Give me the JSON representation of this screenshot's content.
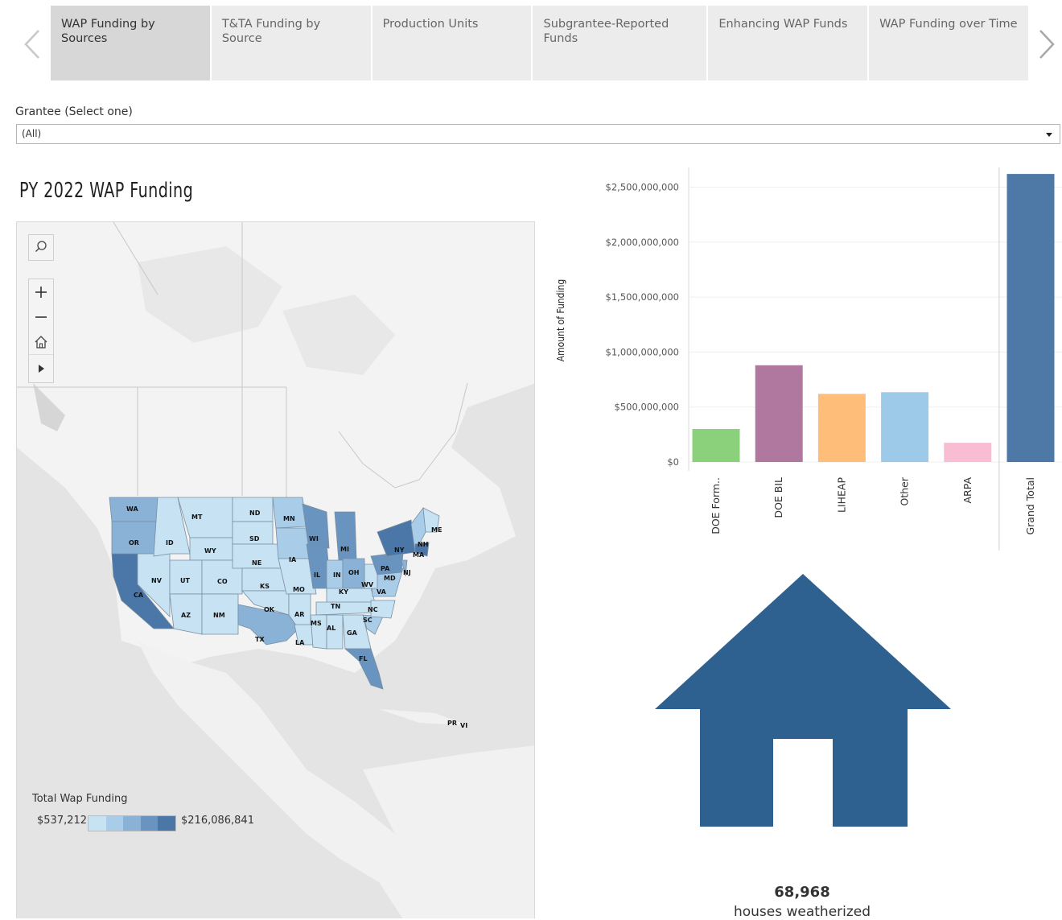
{
  "tabs": [
    {
      "label": "WAP Funding by Sources",
      "active": true
    },
    {
      "label": "T&TA Funding by Source",
      "active": false
    },
    {
      "label": "Production Units",
      "active": false
    },
    {
      "label": "Subgrantee-Reported Funds",
      "active": false
    },
    {
      "label": "Enhancing WAP Funds",
      "active": false
    },
    {
      "label": "WAP Funding over Time",
      "active": false
    }
  ],
  "filter": {
    "label": "Grantee (Select one)",
    "value": "(All)"
  },
  "title": "PY 2022 WAP Funding",
  "map": {
    "legend_title": "Total Wap Funding",
    "legend_min": "$537,212",
    "legend_max": "$216,086,841",
    "legend_colors": [
      "#c6e2f3",
      "#a9cde8",
      "#89b2d6",
      "#6994c0",
      "#4a76a8"
    ],
    "state_labels": [
      "WA",
      "OR",
      "CA",
      "NV",
      "ID",
      "MT",
      "WY",
      "UT",
      "AZ",
      "CO",
      "NM",
      "ND",
      "SD",
      "NE",
      "KS",
      "OK",
      "TX",
      "MN",
      "IA",
      "MO",
      "AR",
      "LA",
      "WI",
      "IL",
      "MI",
      "IN",
      "OH",
      "KY",
      "TN",
      "MS",
      "AL",
      "GA",
      "FL",
      "SC",
      "NC",
      "VA",
      "WV",
      "PA",
      "NY",
      "MD",
      "ME",
      "NH",
      "MA",
      "NJ",
      "PR",
      "VI"
    ]
  },
  "chart_data": {
    "type": "bar",
    "ylabel": "Amount of Funding",
    "yticks": [
      "$0",
      "$500,000,000",
      "$1,000,000,000",
      "$1,500,000,000",
      "$2,000,000,000",
      "$2,500,000,000"
    ],
    "ylim": [
      0,
      2750000000
    ],
    "categories": [
      "DOE Form..",
      "DOE BIL",
      "LIHEAP",
      "Other",
      "ARPA",
      "Grand Total"
    ],
    "values": [
      300000000,
      880000000,
      620000000,
      635000000,
      175000000,
      2620000000
    ],
    "colors": [
      "#8bd17c",
      "#b0789f",
      "#ffbd7a",
      "#9ecae9",
      "#f8bcd3",
      "#4e79a7"
    ]
  },
  "kpi": {
    "value": "68,968",
    "label": "houses weatherized"
  }
}
